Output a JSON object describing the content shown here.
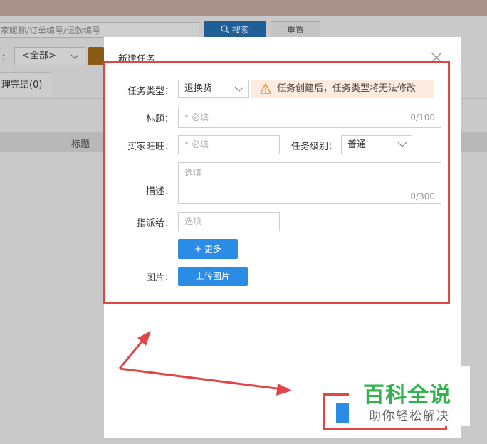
{
  "background": {
    "search_placeholder": "家昵称/订单编号/退款编号",
    "search_button": "搜索",
    "reset_button": "重置",
    "filter_colon": "：",
    "filter_select": "<全部>",
    "tab_label": "理完结(0)",
    "table_header_title": "标题"
  },
  "modal": {
    "title": "新建任务",
    "task_type": {
      "label": "任务类型：",
      "value": "退换货"
    },
    "warning": "任务创建后，任务类型将无法修改",
    "title_field": {
      "label": "标题：",
      "placeholder": "* 必填",
      "counter": "0/100"
    },
    "buyer": {
      "label": "买家旺旺：",
      "placeholder": "* 必填"
    },
    "level": {
      "label": "任务级别：",
      "value": "普通"
    },
    "description": {
      "label": "描述：",
      "placeholder": "选填",
      "counter": "0/300"
    },
    "assign": {
      "label": "指派给：",
      "placeholder": "选填"
    },
    "more_button": "+ 更多",
    "image": {
      "label": "图片：",
      "upload_button": "上传图片"
    }
  },
  "watermark": {
    "title": "百科全说",
    "subtitle": "助你轻松解决"
  },
  "colors": {
    "highlight": "#e24545",
    "primary": "#2b8ce6",
    "warning_bg": "#fcebde",
    "watermark_green": "#2fb34a"
  }
}
